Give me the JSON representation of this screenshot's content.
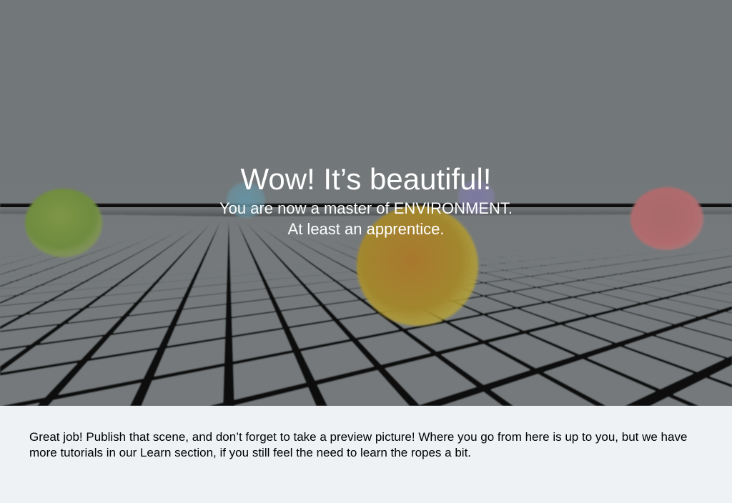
{
  "scene": {
    "title": "Wow! It’s beautiful!",
    "subtitle_line1": "You are now a master of ENVIRONMENT.",
    "subtitle_line2": "At least an apprentice.",
    "colors": {
      "sky": "#727779",
      "floor_tile": "#75797b",
      "floor_grout": "#0d0d0d",
      "ball_green": "#6f8c45",
      "ball_blue": "#5f8fa0",
      "ball_purple": "#7a76a0",
      "ball_yellow": "#b08a2c",
      "ball_red": "#b06a6c"
    }
  },
  "panel": {
    "message": "Great job! Publish that scene, and don’t forget to take a preview picture! Where you go from here is up to you, but we have more tutorials in our Learn section, if you still feel the need to learn the ropes a bit.",
    "background": "#eef2f5"
  }
}
